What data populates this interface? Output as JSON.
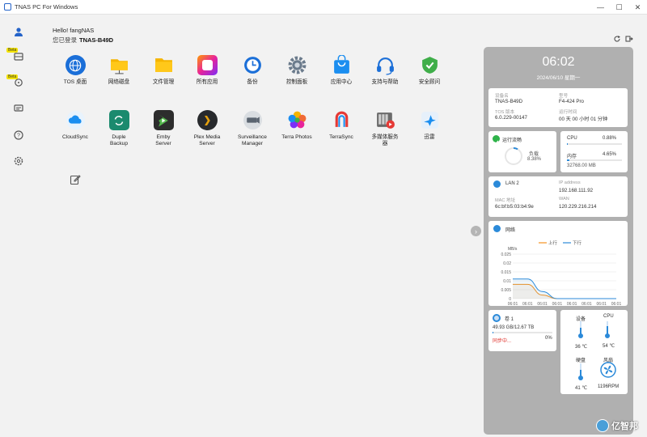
{
  "window": {
    "title": "TNAS PC For Windows",
    "minimize": "—",
    "maximize": "☐",
    "close": "✕"
  },
  "sidebar": {
    "beta": "Beta"
  },
  "header": {
    "greeting": "Hello! fangNAS",
    "login_prefix": "您已登录",
    "device": "TNAS-B49D"
  },
  "apps": [
    {
      "label": "TOS 桌面"
    },
    {
      "label": "网络磁盘"
    },
    {
      "label": "文件管理"
    },
    {
      "label": "所有应用"
    },
    {
      "label": "备份"
    },
    {
      "label": "控制面板"
    },
    {
      "label": "应用中心"
    },
    {
      "label": "支持与帮助"
    },
    {
      "label": "安全顾问"
    },
    {
      "label": "CloudSync"
    },
    {
      "label": "Duple\nBackup"
    },
    {
      "label": "Emby\nServer"
    },
    {
      "label": "Plex Media\nServer"
    },
    {
      "label": "Surveillance\nManager"
    },
    {
      "label": "Terra Photos"
    },
    {
      "label": "TerraSync"
    },
    {
      "label": "多媒体服务\n器"
    },
    {
      "label": "迅雷"
    }
  ],
  "panel": {
    "time": "06:02",
    "date": "2024/06/10 星期一",
    "device_info": {
      "name_label": "设备名",
      "name": "TNAS-B49D",
      "model_label": "型号",
      "model": "F4-424 Pro",
      "tos_label": "TOS 版本",
      "tos": "6.0.229-00147",
      "uptime_label": "运行时间",
      "uptime": "00 天 00 小时 01 分钟"
    },
    "status": {
      "label": "运行流畅",
      "load_label": "负载",
      "load": "8.38%",
      "load_value": 0.0838
    },
    "resources": {
      "cpu_label": "CPU",
      "cpu": "0.88%",
      "cpu_value": 0.0088,
      "mem_label": "内存",
      "mem": "4.65%",
      "mem_value": 0.0465,
      "mem_total": "32768.00 MB"
    },
    "network_info": {
      "lan": "LAN 2",
      "ip_label": "IP address",
      "ip": "192.168.111.92",
      "mac_label": "MAC 地址",
      "mac": "6c:bf:b5:03:b4:9e",
      "wan_label": "WAN",
      "wan": "120.229.216.214"
    },
    "network_chart": {
      "title": "网络",
      "unit": "MB/s",
      "legend_up": "上行",
      "legend_down": "下行"
    },
    "volume": {
      "name": "卷 1",
      "usage": "49.93 GB/12.67 TB",
      "status": "同步中...",
      "percent": "0%",
      "fill": 0.0039
    },
    "temps": {
      "device_label": "设备",
      "device": "36 ℃",
      "cpu_label": "CPU",
      "cpu": "54 ℃",
      "disk_label": "硬盘",
      "disk": "41 ℃",
      "fan_label": "风扇",
      "fan": "1196RPM"
    }
  },
  "colors": {
    "upload": "#f5921f",
    "download": "#2b8ad9",
    "status_green": "#2fb34a",
    "sync_red": "#e0322b"
  },
  "chart_data": {
    "type": "line",
    "title": "网络",
    "ylabel": "MB/s",
    "x": [
      "06:01",
      "06:01",
      "06:01",
      "06:01",
      "06:01",
      "06:01",
      "06:01",
      "06:01"
    ],
    "ylim": [
      0,
      0.025
    ],
    "yticks": [
      0,
      0.005,
      0.01,
      0.015,
      0.02,
      0.025
    ],
    "series": [
      {
        "name": "上行",
        "color": "#f5921f",
        "values": [
          0.008,
          0.008,
          0.002,
          0,
          0,
          0,
          0,
          0
        ]
      },
      {
        "name": "下行",
        "color": "#2b8ad9",
        "values": [
          0.011,
          0.011,
          0.004,
          0,
          0,
          0,
          0,
          0
        ]
      }
    ],
    "legend": "top-center",
    "grid": true
  },
  "watermark": "亿智邦"
}
